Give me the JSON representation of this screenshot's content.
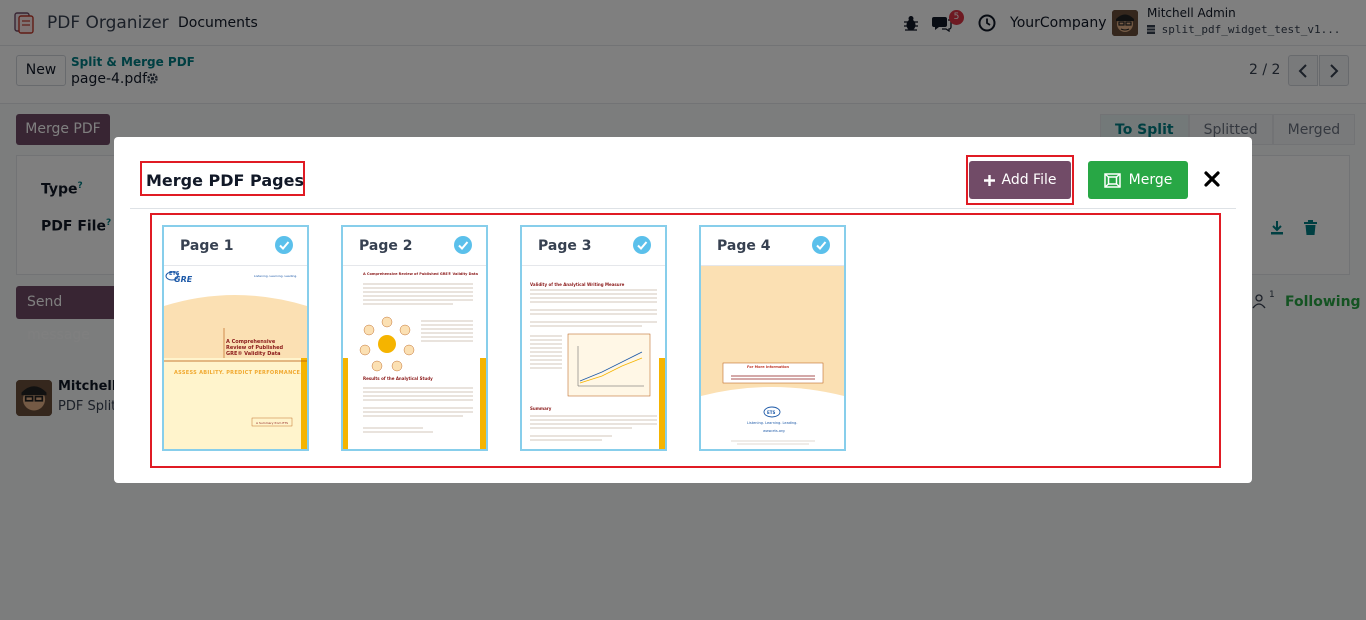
{
  "navbar": {
    "app_title": "PDF Organizer",
    "menu_documents": "Documents",
    "chat_badge": "5",
    "company": "YourCompany",
    "user_name": "Mitchell Admin",
    "db_name": "split_pdf_widget_test_v1..."
  },
  "control_panel": {
    "new_label": "New",
    "breadcrumb_parent": "Split & Merge PDF",
    "breadcrumb_current": "page-4.pdf",
    "pager_value": "2 / 2"
  },
  "form": {
    "merge_pdf_label": "Merge PDF",
    "stages": [
      "To Split",
      "Splitted",
      "Merged"
    ],
    "active_stage": "To Split",
    "field_type_label": "Type",
    "field_pdf_label": "PDF File",
    "help_mark": "?"
  },
  "chatter": {
    "send_message_label": "Send message",
    "followers_count": "1",
    "following_label": "Following",
    "author": "Mitchell A",
    "body": "PDF Split"
  },
  "modal": {
    "title": "Merge PDF Pages",
    "add_file_label": "Add File",
    "merge_label": "Merge",
    "pages": [
      {
        "label": "Page 1",
        "selected": true
      },
      {
        "label": "Page 2",
        "selected": true
      },
      {
        "label": "Page 3",
        "selected": true
      },
      {
        "label": "Page 4",
        "selected": true
      }
    ]
  },
  "thumbnails": {
    "p1_logo": "ETS",
    "p1_brand": "GRE",
    "p1_tagline": "Listening. Learning. Leading.",
    "p1_title": "A Comprehensive Review of Published GRE® Validity Data",
    "p1_slogan": "ASSESS ABILITY. PREDICT PERFORMANCE.",
    "p1_footer": "A Summary from ETS",
    "p2_title": "A Comprehensive Review of Published GRE® Validity Data",
    "p2_section": "Results of the Analytical Study",
    "p3_title": "Validity of the Analytical Writing Measure",
    "p3_section": "Summary",
    "p4_box_title": "For More Information",
    "p4_logo": "ETS",
    "p4_tagline": "Listening. Learning. Leading.",
    "p4_url": "www.ets.org"
  },
  "colors": {
    "brand": "#714b67",
    "success": "#28a745",
    "link": "#017e84",
    "highlight_box": "#e01b24",
    "card_border": "#87ceeb",
    "check": "#5bc0eb"
  }
}
